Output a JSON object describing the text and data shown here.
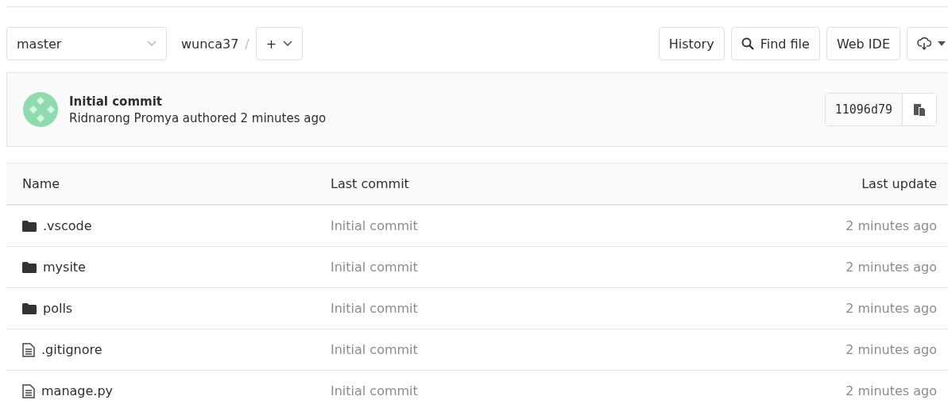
{
  "toolbar": {
    "branch": "master",
    "path": "wunca37",
    "path_separator": "/",
    "add_label": "+",
    "buttons": [
      {
        "kind": "text",
        "label": "History"
      },
      {
        "kind": "search",
        "label": "Find file"
      },
      {
        "kind": "text",
        "label": "Web IDE"
      },
      {
        "kind": "download"
      }
    ]
  },
  "commit": {
    "title": "Initial commit",
    "author_line": "Ridnarong Promya authored 2 minutes ago",
    "sha": "11096d79"
  },
  "table": {
    "columns": [
      "Name",
      "Last commit",
      "Last update"
    ],
    "rows": [
      {
        "kind": "folder",
        "name": ".vscode",
        "last_commit": "Initial commit",
        "last_update": "2 minutes ago"
      },
      {
        "kind": "folder",
        "name": "mysite",
        "last_commit": "Initial commit",
        "last_update": "2 minutes ago"
      },
      {
        "kind": "folder",
        "name": "polls",
        "last_commit": "Initial commit",
        "last_update": "2 minutes ago"
      },
      {
        "kind": "file",
        "name": ".gitignore",
        "last_commit": "Initial commit",
        "last_update": "2 minutes ago"
      },
      {
        "kind": "file",
        "name": "manage.py",
        "last_commit": "Initial commit",
        "last_update": "2 minutes ago"
      }
    ]
  }
}
